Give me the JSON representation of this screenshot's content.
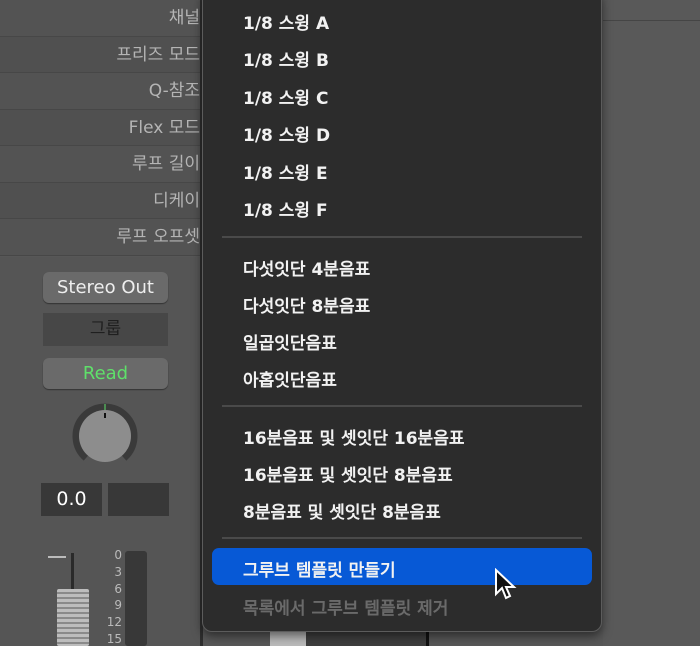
{
  "left_panel": {
    "rows": [
      "채널",
      "프리즈 모드",
      "Q-참조",
      "Flex 모드",
      "루프 길이",
      "디케이",
      "루프 오프셋"
    ]
  },
  "channel_strip": {
    "output": "Stereo Out",
    "group": "그룹",
    "automation": "Read",
    "volume": "0.0",
    "pan_value": "",
    "meter_scale": [
      "0",
      "3",
      "6",
      "9",
      "12",
      "15"
    ]
  },
  "menu": {
    "section1": [
      "1/8 스윙 A",
      "1/8 스윙 B",
      "1/8 스윙 C",
      "1/8 스윙 D",
      "1/8 스윙 E",
      "1/8 스윙 F"
    ],
    "section2": [
      "다섯잇단 4분음표",
      "다섯잇단 8분음표",
      "일곱잇단음표",
      "아홉잇단음표"
    ],
    "section3": [
      "16분음표 및 셋잇단 16분음표",
      "16분음표 및 셋잇단 8분음표",
      "8분음표 및 셋잇단 8분음표"
    ],
    "create": "그루브 템플릿 만들기",
    "remove": "목록에서 그루브 템플릿 제거"
  },
  "colors": {
    "highlight": "#0759d6",
    "read": "#5fe06a"
  }
}
